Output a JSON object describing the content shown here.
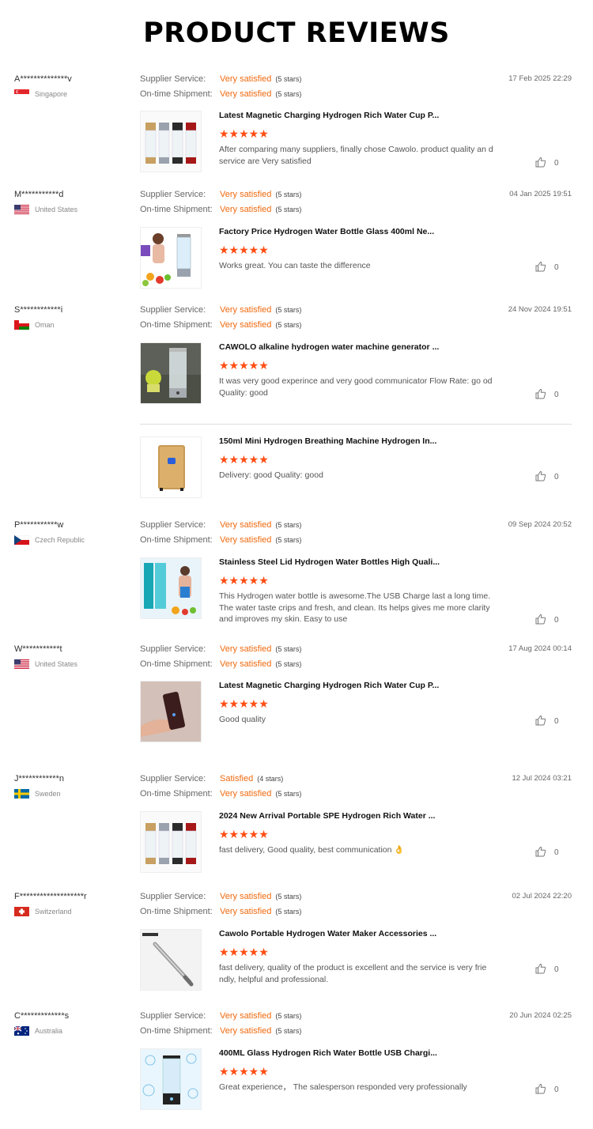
{
  "page_title": "PRODUCT REVIEWS",
  "labels": {
    "supplier": "Supplier Service:",
    "shipment": "On-time Shipment:"
  },
  "reviews": [
    {
      "user": "A**************v",
      "country": "Singapore",
      "flag": "sg",
      "date": "17 Feb 2025 22:29",
      "supplier": "Very satisfied",
      "supplier_stars": "(5 stars)",
      "shipment": "Very satisfied",
      "shipment_stars": "(5 stars)",
      "products": [
        {
          "name": "Latest Magnetic Charging Hydrogen Rich Water Cup P...",
          "rating": "★★★★★",
          "text": "After comparing many suppliers, finally chose Cawolo. product quality an d service are Very satisfied",
          "likes": "0",
          "thumb": "bottles"
        }
      ]
    },
    {
      "user": "M***********d",
      "country": "United States",
      "flag": "us",
      "date": "04 Jan 2025 19:51",
      "supplier": "Very satisfied",
      "supplier_stars": "(5 stars)",
      "shipment": "Very satisfied",
      "shipment_stars": "(5 stars)",
      "products": [
        {
          "name": "Factory Price Hydrogen Water Bottle Glass 400ml Ne...",
          "rating": "★★★★★",
          "text": "Works great. You can taste the difference",
          "likes": "0",
          "thumb": "woman"
        }
      ]
    },
    {
      "user": "S************i",
      "country": "Oman",
      "flag": "om",
      "date": "24 Nov 2024 19:51",
      "supplier": "Very satisfied",
      "supplier_stars": "(5 stars)",
      "shipment": "Very satisfied",
      "shipment_stars": "(5 stars)",
      "products": [
        {
          "name": "CAWOLO alkaline hydrogen water machine generator ...",
          "rating": "★★★★★",
          "text": "It was very good experince and very good communicator  Flow Rate:  go od  Quality:   good",
          "likes": "0",
          "thumb": "bottle-plant"
        },
        {
          "name": "150ml Mini Hydrogen Breathing Machine Hydrogen In...",
          "rating": "★★★★★",
          "text": "Delivery:  good  Quality:  good",
          "likes": "0",
          "thumb": "machine"
        }
      ]
    },
    {
      "user": "P***********w",
      "country": "Czech Republic",
      "flag": "cz",
      "date": "09 Sep 2024 20:52",
      "supplier": "Very satisfied",
      "supplier_stars": "(5 stars)",
      "shipment": "Very satisfied",
      "shipment_stars": "(5 stars)",
      "products": [
        {
          "name": "Stainless Steel Lid Hydrogen Water Bottles High Quali...",
          "rating": "★★★★★",
          "text": "This Hydrogen water bottle is awesome.The USB Charge last a long time. The water taste crips and fresh, and clean. Its helps gives me more clarity and improves my skin. Easy to use",
          "likes": "0",
          "thumb": "woman-blue"
        }
      ]
    },
    {
      "user": "W***********t",
      "country": "United States",
      "flag": "us",
      "date": "17 Aug 2024 00:14",
      "supplier": "Very satisfied",
      "supplier_stars": "(5 stars)",
      "shipment": "Very satisfied",
      "shipment_stars": "(5 stars)",
      "products": [
        {
          "name": "Latest Magnetic Charging Hydrogen Rich Water Cup P...",
          "rating": "★★★★★",
          "text": "Good quality",
          "likes": "0",
          "thumb": "hand"
        }
      ]
    },
    {
      "user": "J************n",
      "country": "Sweden",
      "flag": "se",
      "date": "12 Jul 2024 03:21",
      "supplier": "Satisfied",
      "supplier_stars": "(4 stars)",
      "shipment": "Very satisfied",
      "shipment_stars": "(5 stars)",
      "products": [
        {
          "name": "2024 New Arrival Portable SPE Hydrogen Rich Water ...",
          "rating": "★★★★★",
          "text": "fast delivery, Good quality, best communication 👌",
          "likes": "0",
          "thumb": "bottles"
        }
      ]
    },
    {
      "user": "F*******************r",
      "country": "Switzerland",
      "flag": "ch",
      "date": "02 Jul 2024 22:20",
      "supplier": "Very satisfied",
      "supplier_stars": "(5 stars)",
      "shipment": "Very satisfied",
      "shipment_stars": "(5 stars)",
      "products": [
        {
          "name": "Cawolo Portable Hydrogen Water Maker Accessories ...",
          "rating": "★★★★★",
          "text": "fast delivery, quality of the product is excellent and the service is very frie ndly, helpful and professional.",
          "likes": "0",
          "thumb": "tube"
        }
      ]
    },
    {
      "user": "C*************s",
      "country": "Australia",
      "flag": "au",
      "date": "20 Jun 2024 02:25",
      "supplier": "Very satisfied",
      "supplier_stars": "(5 stars)",
      "shipment": "Very satisfied",
      "shipment_stars": "(5 stars)",
      "products": [
        {
          "name": "400ML Glass Hydrogen Rich Water Bottle USB Chargi...",
          "rating": "★★★★★",
          "text": "Great experience，  The salesperson responded very professionally",
          "likes": "0",
          "thumb": "bubbles"
        }
      ]
    }
  ]
}
